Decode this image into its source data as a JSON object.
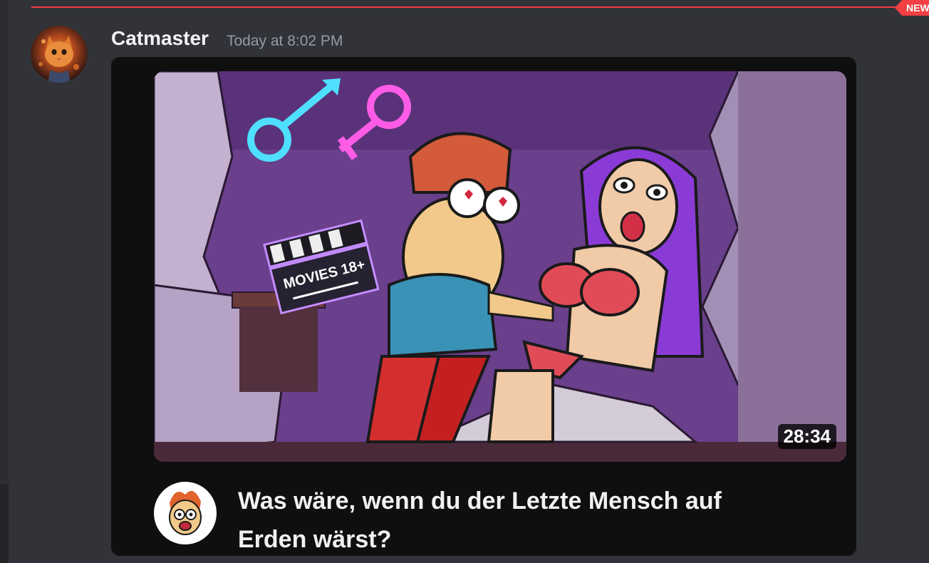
{
  "divider": {
    "badge": "NEW"
  },
  "message": {
    "author": "Catmaster",
    "timestamp": "Today at 8:02 PM",
    "avatar_icon": "cat-avatar-icon"
  },
  "embed": {
    "thumbnail_icon": "video-thumbnail",
    "duration": "28:34",
    "channel_icon": "channel-avatar-icon",
    "title": "Was wäre, wenn du der Letzte Mensch auf Erden wärst?",
    "clapper_text": "MOVIES 18+"
  },
  "colors": {
    "background": "#313338",
    "divider_red": "#f23f43",
    "embed_bg": "#0f0f0f",
    "username": "#f2f3f5",
    "timestamp": "#949ba4"
  }
}
